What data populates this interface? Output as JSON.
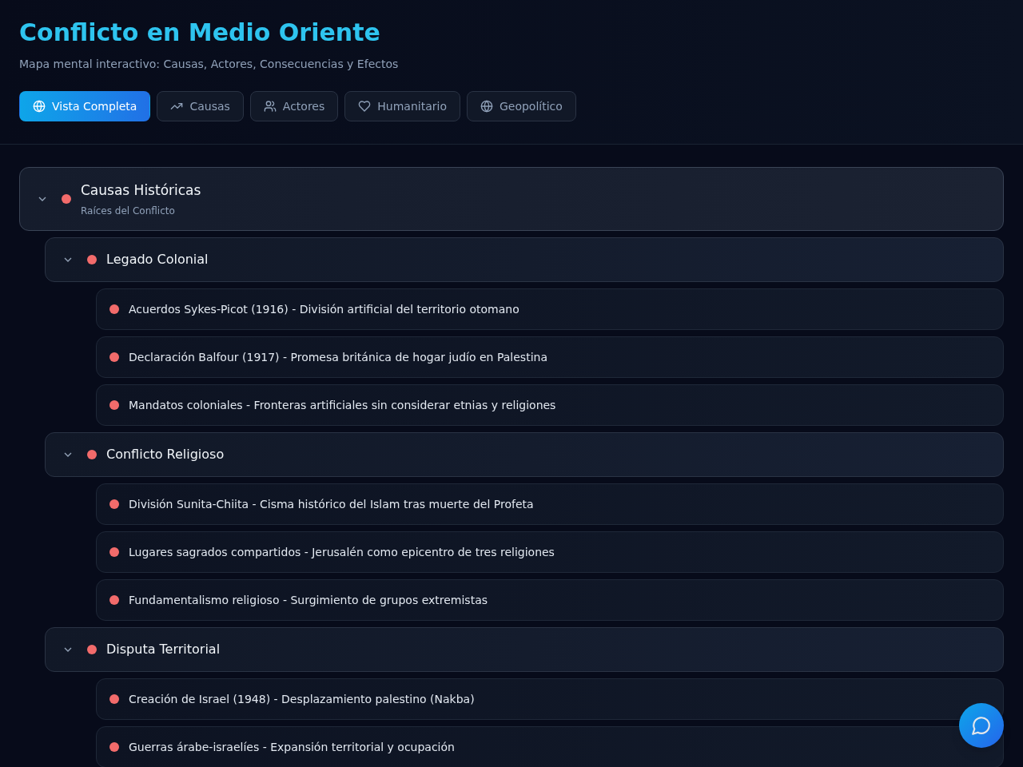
{
  "header": {
    "title": "Conflicto en Medio Oriente",
    "subtitle": "Mapa mental interactivo: Causas, Actores, Consecuencias y Efectos"
  },
  "filters": [
    {
      "label": "Vista Completa",
      "selected": true
    },
    {
      "label": "Causas",
      "selected": false
    },
    {
      "label": "Actores",
      "selected": false
    },
    {
      "label": "Humanitario",
      "selected": false
    },
    {
      "label": "Geopolítico",
      "selected": false
    }
  ],
  "tree": [
    {
      "title": "Causas Históricas",
      "subtitle": "Raíces del Conflicto",
      "expanded": true,
      "children": [
        {
          "title": "Legado Colonial",
          "expanded": true,
          "children": [
            {
              "title": "Acuerdos Sykes-Picot (1916) - División artificial del territorio otomano"
            },
            {
              "title": "Declaración Balfour (1917) - Promesa británica de hogar judío en Palestina"
            },
            {
              "title": "Mandatos coloniales - Fronteras artificiales sin considerar etnias y religiones"
            }
          ]
        },
        {
          "title": "Conflicto Religioso",
          "expanded": true,
          "children": [
            {
              "title": "División Sunita-Chiita - Cisma histórico del Islam tras muerte del Profeta"
            },
            {
              "title": "Lugares sagrados compartidos - Jerusalén como epicentro de tres religiones"
            },
            {
              "title": "Fundamentalismo religioso - Surgimiento de grupos extremistas"
            }
          ]
        },
        {
          "title": "Disputa Territorial",
          "expanded": true,
          "children": [
            {
              "title": "Creación de Israel (1948) - Desplazamiento palestino (Nakba)"
            },
            {
              "title": "Guerras árabe-israelíes - Expansión territorial y ocupación"
            }
          ]
        }
      ]
    }
  ]
}
